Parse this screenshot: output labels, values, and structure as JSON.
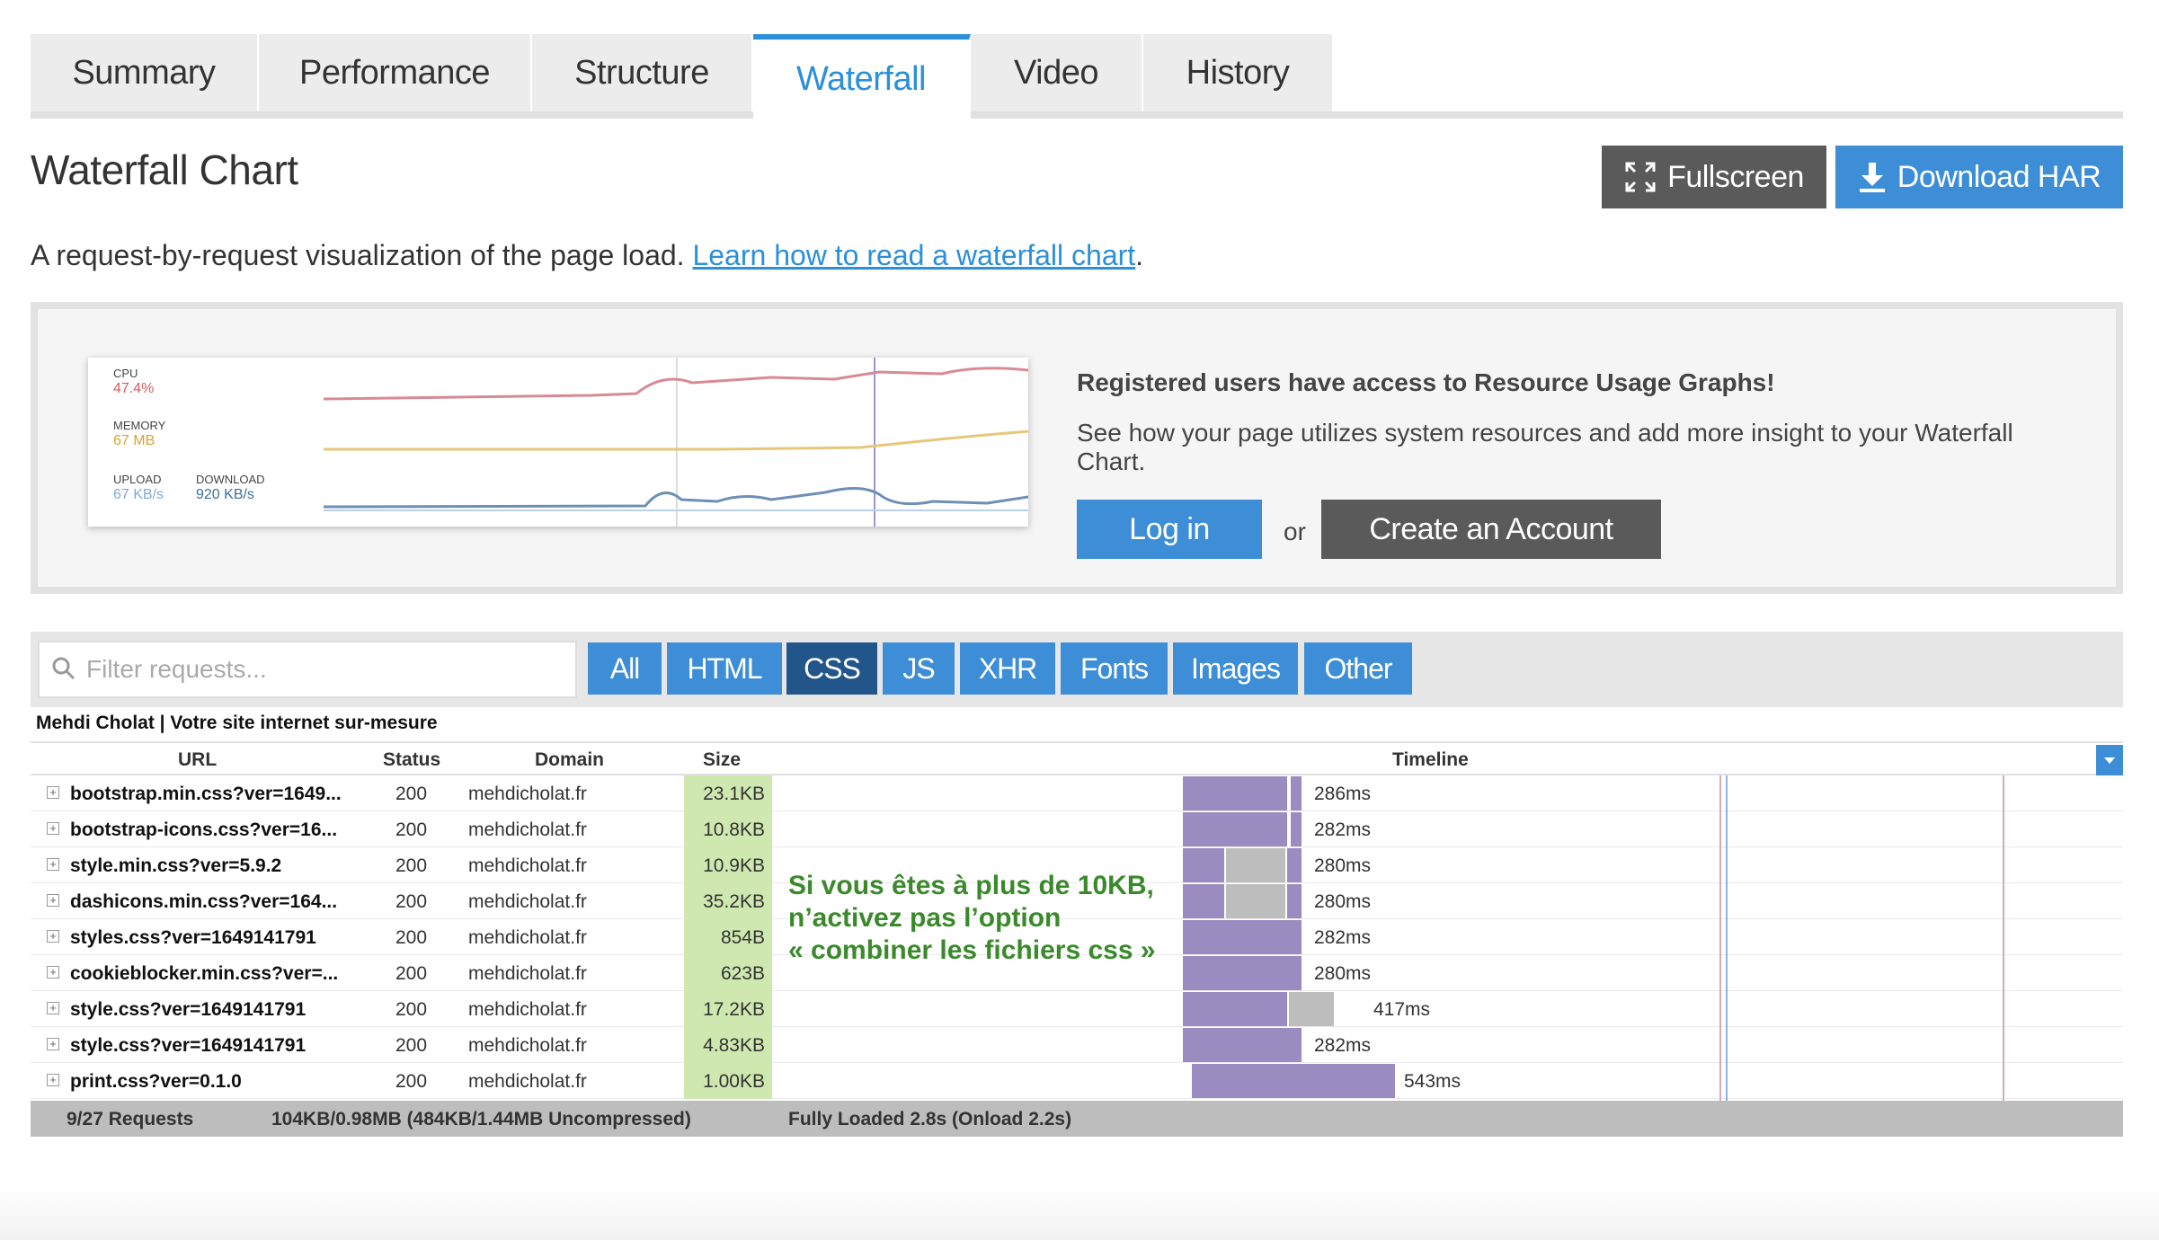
{
  "tabs": [
    "Summary",
    "Performance",
    "Structure",
    "Waterfall",
    "Video",
    "History"
  ],
  "active_tab": "Waterfall",
  "header": {
    "title": "Waterfall Chart",
    "fullscreen_label": "Fullscreen",
    "download_label": "Download HAR"
  },
  "description": {
    "text": "A request-by-request visualization of the page load. ",
    "link": "Learn how to read a waterfall chart",
    "end": "."
  },
  "promo": {
    "graph": {
      "cpu_label": "CPU",
      "cpu_value": "47.4%",
      "memory_label": "MEMORY",
      "memory_value": "67 MB",
      "upload_label": "UPLOAD",
      "upload_value": "67 KB/s",
      "download_label": "DOWNLOAD",
      "download_value": "920 KB/s"
    },
    "title": "Registered users have access to Resource Usage Graphs!",
    "text": "See how your page utilizes system resources and add more insight to your Waterfall Chart.",
    "login_label": "Log in",
    "or": "or",
    "create_label": "Create an Account"
  },
  "filter": {
    "placeholder": "Filter requests...",
    "buttons": [
      "All",
      "HTML",
      "CSS",
      "JS",
      "XHR",
      "Fonts",
      "Images",
      "Other"
    ],
    "active": "CSS"
  },
  "page_title": "Mehdi Cholat | Votre site internet sur-mesure",
  "columns": {
    "url": "URL",
    "status": "Status",
    "domain": "Domain",
    "size": "Size",
    "timeline": "Timeline"
  },
  "rows": [
    {
      "url": "bootstrap.min.css?ver=1649...",
      "status": "200",
      "domain": "mehdicholat.fr",
      "size": "23.1KB",
      "time": "286ms"
    },
    {
      "url": "bootstrap-icons.css?ver=16...",
      "status": "200",
      "domain": "mehdicholat.fr",
      "size": "10.8KB",
      "time": "282ms"
    },
    {
      "url": "style.min.css?ver=5.9.2",
      "status": "200",
      "domain": "mehdicholat.fr",
      "size": "10.9KB",
      "time": "280ms"
    },
    {
      "url": "dashicons.min.css?ver=164...",
      "status": "200",
      "domain": "mehdicholat.fr",
      "size": "35.2KB",
      "time": "280ms"
    },
    {
      "url": "styles.css?ver=1649141791",
      "status": "200",
      "domain": "mehdicholat.fr",
      "size": "854B",
      "time": "282ms"
    },
    {
      "url": "cookieblocker.min.css?ver=...",
      "status": "200",
      "domain": "mehdicholat.fr",
      "size": "623B",
      "time": "280ms"
    },
    {
      "url": "style.css?ver=1649141791",
      "status": "200",
      "domain": "mehdicholat.fr",
      "size": "17.2KB",
      "time": "417ms"
    },
    {
      "url": "style.css?ver=1649141791",
      "status": "200",
      "domain": "mehdicholat.fr",
      "size": "4.83KB",
      "time": "282ms"
    },
    {
      "url": "print.css?ver=0.1.0",
      "status": "200",
      "domain": "mehdicholat.fr",
      "size": "1.00KB",
      "time": "543ms"
    }
  ],
  "note": [
    "Si vous êtes à plus de 10KB,",
    "n’activez pas l’option",
    "« combiner les fichiers css »"
  ],
  "footer": {
    "requests": "9/27 Requests",
    "size": "104KB/0.98MB  (484KB/1.44MB Uncompressed)",
    "loaded": "Fully Loaded 2.8s  (Onload 2.2s)"
  },
  "colors": {
    "accent": "#3d8ed6",
    "active_filter": "#22568a",
    "dark_button": "#5a5a5a",
    "size_cell": "#cfe8b0",
    "bar_purple": "#9a8cc1",
    "bar_grey": "#bdbdbd",
    "note_green": "#3a8a2c"
  }
}
